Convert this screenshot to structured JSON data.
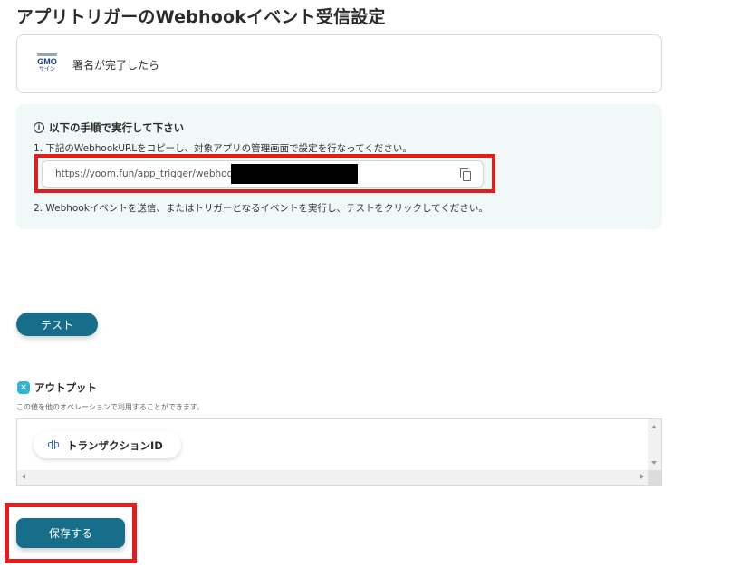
{
  "page": {
    "title": "アプリトリガーのWebhookイベント受信設定"
  },
  "trigger": {
    "logo_text": "GMO",
    "logo_sub": "サイン",
    "label": "署名が完了したら",
    "icon": "gmo-sign-logo"
  },
  "instructions": {
    "icon": "info-icon",
    "title": "以下の手順で実行して下さい",
    "step1": "1. 下記のWebhookURLをコピーし、対象アプリの管理画面で設定を行なってください。",
    "step2": "2. Webhookイベントを送信、またはトリガーとなるイベントを実行し、テストをクリックしてください。",
    "webhook_url": "https://yoom.fun/app_trigger/webhooks/",
    "copy_icon": "copy-icon"
  },
  "actions": {
    "test_label": "テスト",
    "save_label": "保存する"
  },
  "output": {
    "icon": "output-icon",
    "title": "アウトプット",
    "description": "この値を他のオペレーションで利用することができます。",
    "items": [
      {
        "label": "トランザクションID",
        "icon": "link-icon"
      }
    ]
  },
  "colors": {
    "primary": "#176e8a",
    "highlight": "#e11d1d",
    "instruction_bg": "#f1f8f8",
    "output_icon": "#2fb6d6"
  }
}
